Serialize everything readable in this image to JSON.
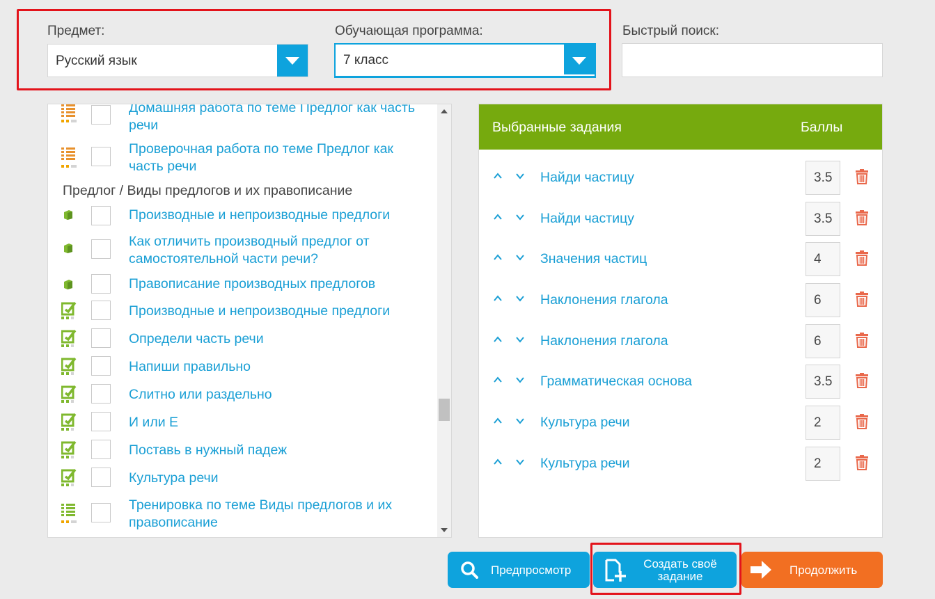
{
  "filters": {
    "subject_label": "Предмет:",
    "subject_value": "Русский язык",
    "program_label": "Обучающая программа:",
    "program_value": "7 класс",
    "search_label": "Быстрый поиск:",
    "search_value": ""
  },
  "left_list": {
    "rows": [
      {
        "icon": "list-orange-icon",
        "text": "Домашняя работа по теме Предлог как часть речи"
      },
      {
        "icon": "list-orange-icon",
        "text": "Проверочная работа по теме Предлог как часть речи"
      },
      {
        "icon": "book-green-icon",
        "text": "Производные и непроизводные предлоги"
      },
      {
        "icon": "book-green-icon",
        "text": "Как отличить производный предлог от самостоятельной части речи?"
      },
      {
        "icon": "book-green-icon",
        "text": "Правописание производных предлогов"
      },
      {
        "icon": "edit-green-icon",
        "text": "Производные и непроизводные предлоги"
      },
      {
        "icon": "edit-green-icon",
        "text": "Определи часть речи"
      },
      {
        "icon": "edit-green-icon",
        "text": "Напиши правильно"
      },
      {
        "icon": "edit-green-icon",
        "text": "Слитно или раздельно"
      },
      {
        "icon": "edit-green-icon",
        "text": "И или Е"
      },
      {
        "icon": "edit-green-icon",
        "text": "Поставь в нужный падеж"
      },
      {
        "icon": "edit-green-icon",
        "text": "Культура речи"
      },
      {
        "icon": "list-green-icon",
        "text": "Тренировка по теме Виды предлогов и их правописание"
      }
    ],
    "section_title": "Предлог / Виды предлогов и их правописание"
  },
  "selected": {
    "title": "Выбранные задания",
    "points_header": "Баллы",
    "tasks": [
      {
        "name": "Найди частицу",
        "score": "3.5"
      },
      {
        "name": "Найди частицу",
        "score": "3.5"
      },
      {
        "name": "Значения частиц",
        "score": "4"
      },
      {
        "name": "Наклонения глагола",
        "score": "6"
      },
      {
        "name": "Наклонения глагола",
        "score": "6"
      },
      {
        "name": "Грамматическая основа",
        "score": "3.5"
      },
      {
        "name": "Культура речи",
        "score": "2"
      },
      {
        "name": "Культура речи",
        "score": "2"
      }
    ]
  },
  "buttons": {
    "preview": "Предпросмотр",
    "create_line1": "Создать своё",
    "create_line2": "задание",
    "continue": "Продолжить"
  },
  "colors": {
    "accent_blue": "#0ea3dd",
    "header_green": "#76aa0e",
    "continue_orange": "#f26f22",
    "highlight_red": "#e3131b",
    "link_blue": "#1a9fd5"
  }
}
